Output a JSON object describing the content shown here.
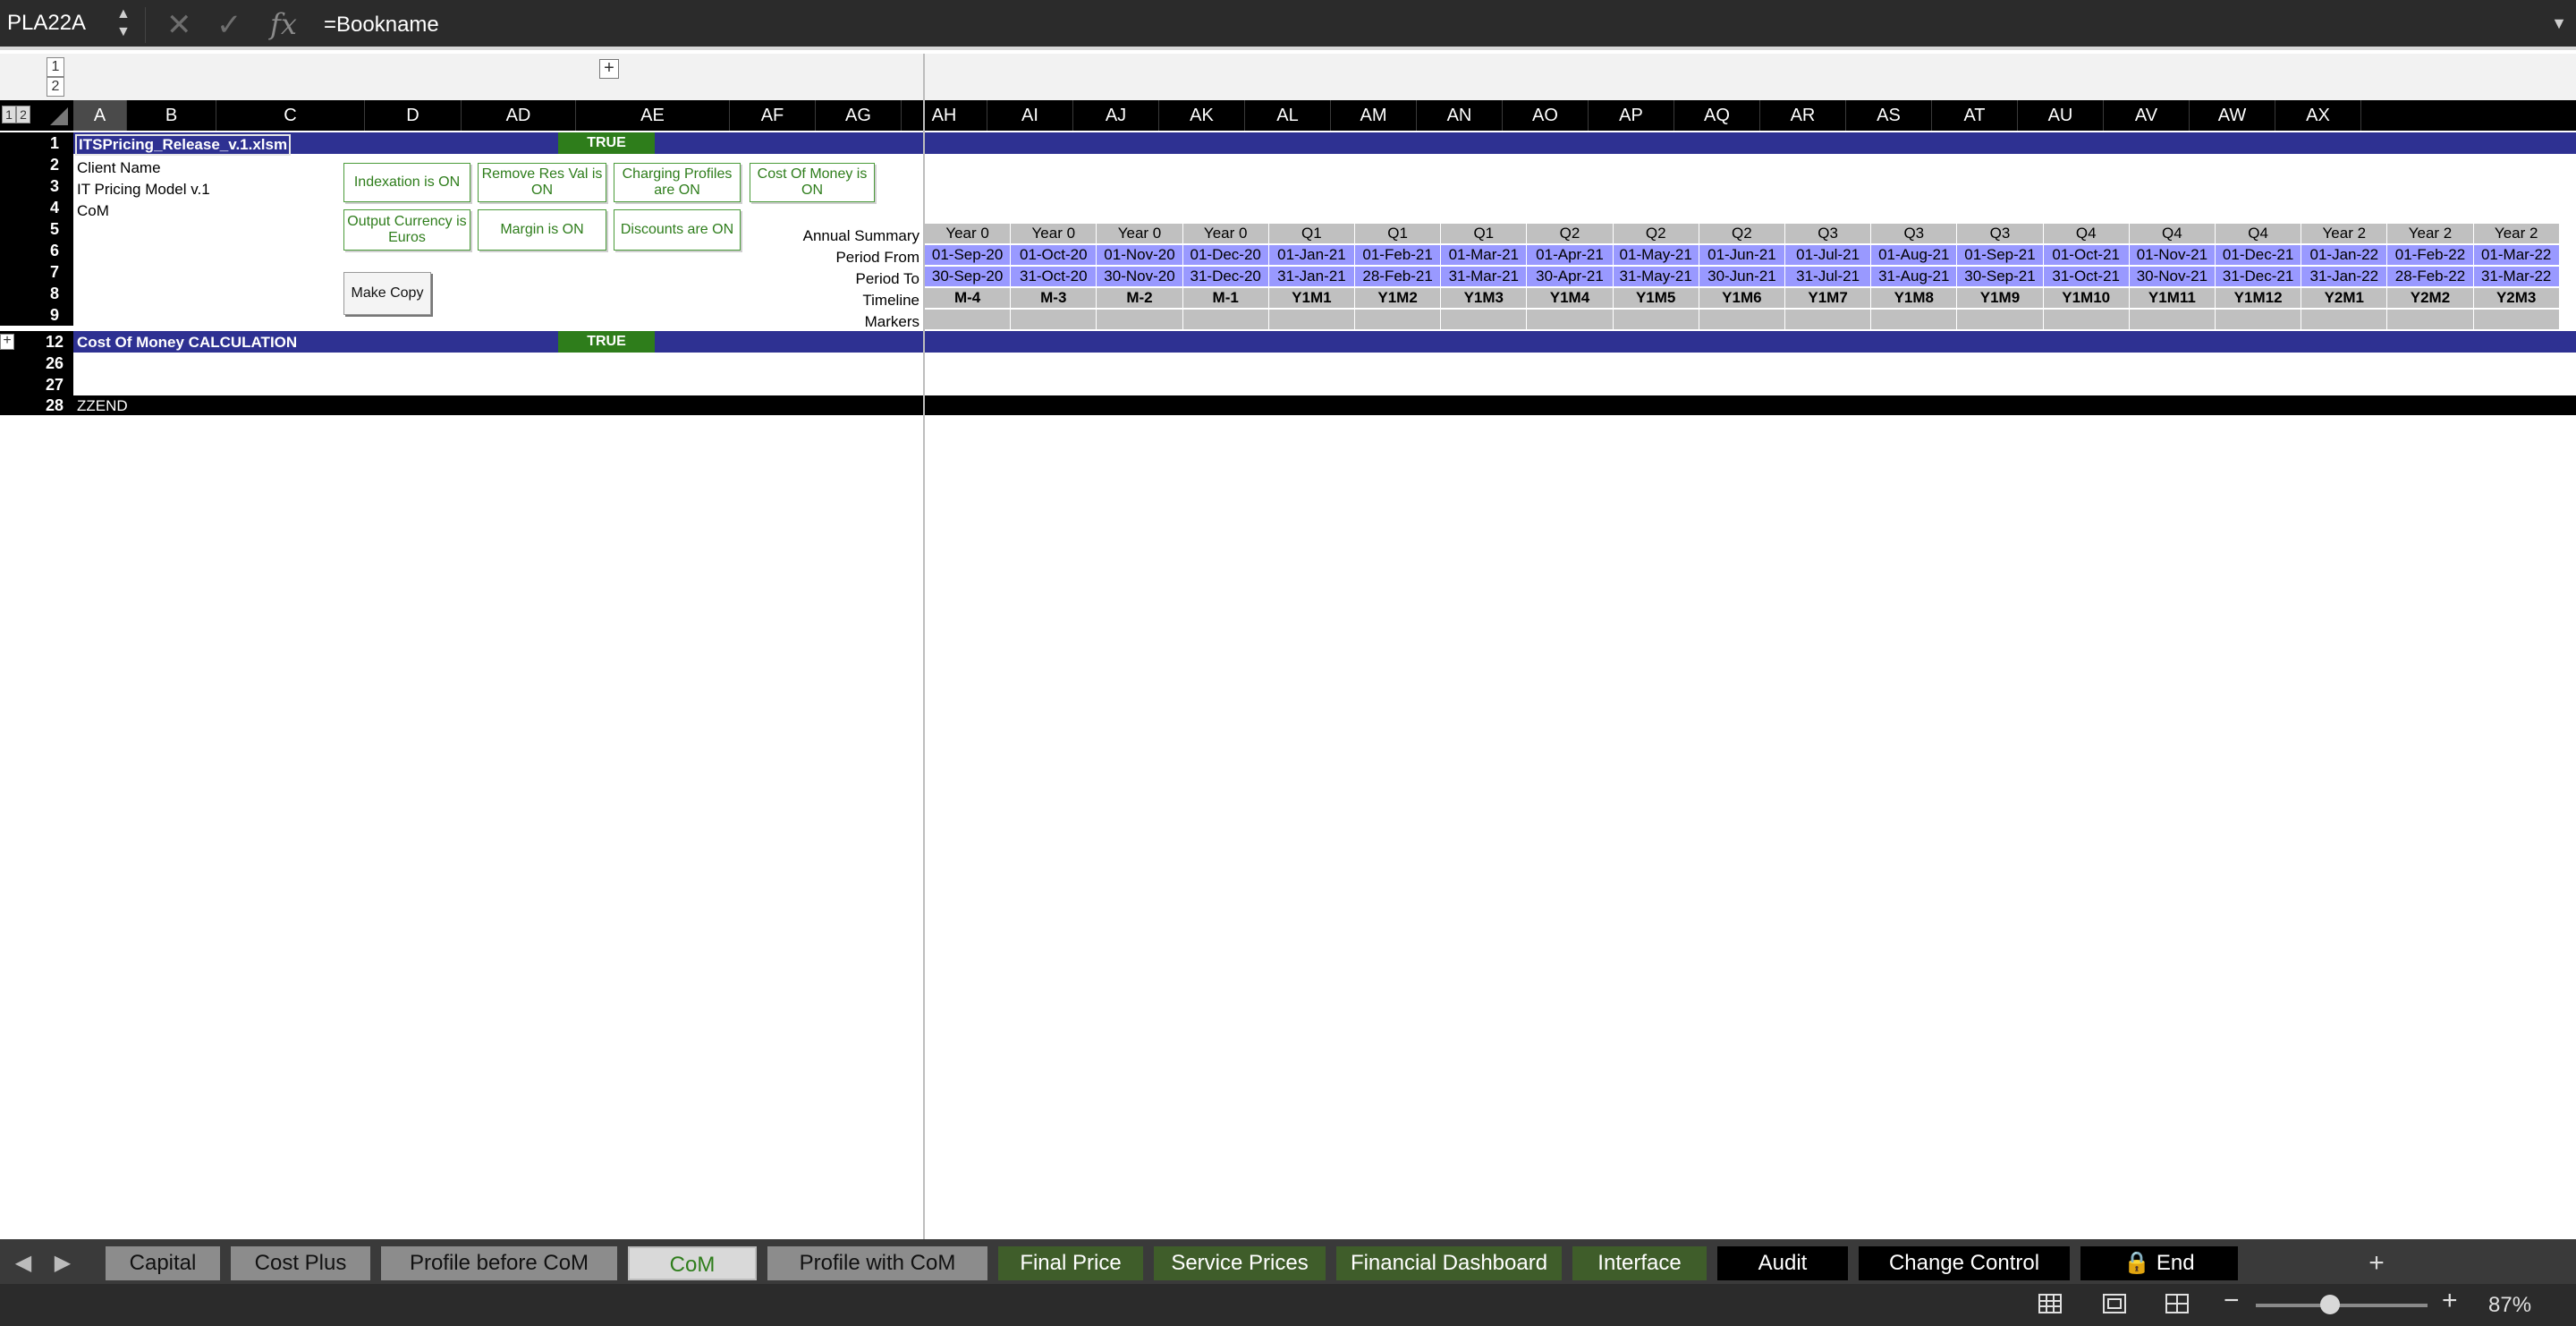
{
  "formula_bar": {
    "name_box": "PLA22A",
    "arrow_up": "▲",
    "arrow_down": "▼",
    "cancel_glyph": "✕",
    "confirm_glyph": "✓",
    "fx_label": "fx",
    "formula": "=Bookname",
    "expand_glyph": "▼"
  },
  "outline": {
    "level1": "1",
    "level2": "2",
    "expand": "+"
  },
  "columns": [
    "A",
    "B",
    "C",
    "D",
    "AD",
    "AE",
    "AF",
    "AG",
    "AH",
    "AI",
    "AJ",
    "AK",
    "AL",
    "AM",
    "AN",
    "AO",
    "AP",
    "AQ",
    "AR",
    "AS",
    "AT",
    "AU",
    "AV",
    "AW",
    "AX"
  ],
  "rows": [
    "1",
    "2",
    "3",
    "4",
    "5",
    "6",
    "7",
    "8",
    "9",
    "12",
    "26",
    "27",
    "28"
  ],
  "cells": {
    "a1": "ITSPricing_Release_v.1.xlsm",
    "d1": "TRUE",
    "a2": "Client Name",
    "a3": "IT Pricing Model v.1",
    "a4": "CoM",
    "a12": "Cost Of Money CALCULATION",
    "d12": "TRUE",
    "a28": "ZZEND"
  },
  "toggles": [
    "Indexation is ON",
    "Remove Res Val is ON",
    "Charging Profiles are ON",
    "Cost Of Money is ON",
    "Output Currency is Euros",
    "Margin is ON",
    "Discounts are ON"
  ],
  "make_copy": "Make Copy",
  "timeline_labels": {
    "annual": "Annual Summary",
    "from": "Period From",
    "to": "Period To",
    "timeline": "Timeline",
    "markers": "Markers"
  },
  "timeline": {
    "annual": [
      "Year 0",
      "Year 0",
      "Year 0",
      "Year 0",
      "Q1",
      "Q1",
      "Q1",
      "Q2",
      "Q2",
      "Q2",
      "Q3",
      "Q3",
      "Q3",
      "Q4",
      "Q4",
      "Q4",
      "Year 2",
      "Year 2",
      "Year 2"
    ],
    "from": [
      "01-Sep-20",
      "01-Oct-20",
      "01-Nov-20",
      "01-Dec-20",
      "01-Jan-21",
      "01-Feb-21",
      "01-Mar-21",
      "01-Apr-21",
      "01-May-21",
      "01-Jun-21",
      "01-Jul-21",
      "01-Aug-21",
      "01-Sep-21",
      "01-Oct-21",
      "01-Nov-21",
      "01-Dec-21",
      "01-Jan-22",
      "01-Feb-22",
      "01-Mar-22"
    ],
    "to": [
      "30-Sep-20",
      "31-Oct-20",
      "30-Nov-20",
      "31-Dec-20",
      "31-Jan-21",
      "28-Feb-21",
      "31-Mar-21",
      "30-Apr-21",
      "31-May-21",
      "30-Jun-21",
      "31-Jul-21",
      "31-Aug-21",
      "30-Sep-21",
      "31-Oct-21",
      "30-Nov-21",
      "31-Dec-21",
      "31-Jan-22",
      "28-Feb-22",
      "31-Mar-22"
    ],
    "codes": [
      "M-4",
      "M-3",
      "M-2",
      "M-1",
      "Y1M1",
      "Y1M2",
      "Y1M3",
      "Y1M4",
      "Y1M5",
      "Y1M6",
      "Y1M7",
      "Y1M8",
      "Y1M9",
      "Y1M10",
      "Y1M11",
      "Y1M12",
      "Y2M1",
      "Y2M2",
      "Y2M3"
    ]
  },
  "sheet_tabs": [
    {
      "label": "Capital",
      "style": "grey"
    },
    {
      "label": "Cost Plus",
      "style": "grey"
    },
    {
      "label": "Profile before CoM",
      "style": "grey"
    },
    {
      "label": "CoM",
      "style": "active"
    },
    {
      "label": "Profile with CoM",
      "style": "grey"
    },
    {
      "label": "Final Price",
      "style": "green"
    },
    {
      "label": "Service Prices",
      "style": "green"
    },
    {
      "label": "Financial Dashboard",
      "style": "green"
    },
    {
      "label": "Interface",
      "style": "green"
    },
    {
      "label": "Audit",
      "style": "black"
    },
    {
      "label": "Change Control",
      "style": "black"
    },
    {
      "label": "🔒 End",
      "style": "black"
    }
  ],
  "tab_nav": {
    "prev": "◀",
    "next": "▶",
    "add": "+"
  },
  "status": {
    "zoom": "87%",
    "zoom_minus": "−",
    "zoom_plus": "+"
  },
  "colors": {
    "header_bar": "#2e3192",
    "true_green": "#2e7d1b",
    "period_blue": "#9999ff",
    "timeline_grey": "#c0c0c0"
  }
}
